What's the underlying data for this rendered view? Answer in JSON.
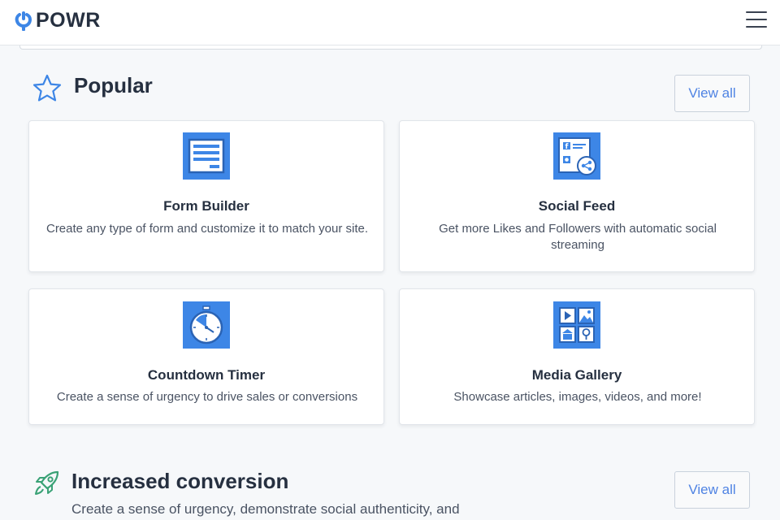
{
  "header": {
    "brand": "POWR",
    "brand_color": "#3d86e6"
  },
  "sections": [
    {
      "title": "Popular",
      "icon": "star-icon",
      "view_all": "View all",
      "cards": [
        {
          "title": "Form Builder",
          "description": "Create any type of form and customize it to match your site.",
          "icon": "form-icon"
        },
        {
          "title": "Social Feed",
          "description": "Get more Likes and Followers with automatic social streaming",
          "icon": "social-feed-icon"
        },
        {
          "title": "Countdown Timer",
          "description": "Create a sense of urgency to drive sales or conversions",
          "icon": "stopwatch-icon"
        },
        {
          "title": "Media Gallery",
          "description": "Showcase articles, images, videos, and more!",
          "icon": "media-gallery-icon"
        }
      ]
    },
    {
      "title": "Increased conversion",
      "icon": "rocket-icon",
      "view_all": "View all",
      "subtitle": "Create a sense of urgency, demonstrate social authenticity, and"
    }
  ],
  "colors": {
    "accent": "#3d86e6",
    "link": "#4f83e3",
    "rocket": "#3aa276",
    "text": "#263040"
  }
}
